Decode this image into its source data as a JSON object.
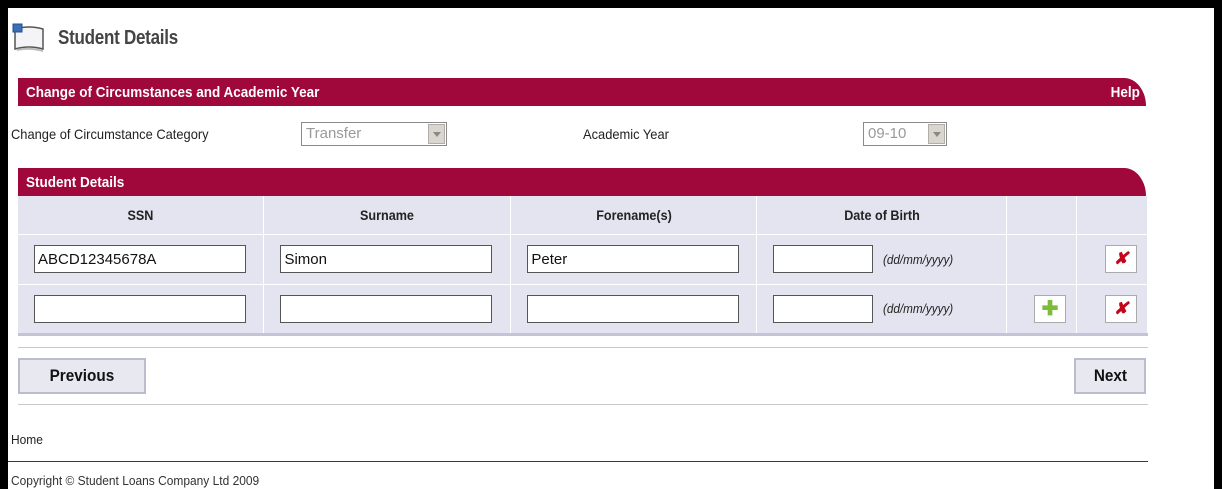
{
  "page": {
    "title": "Student Details"
  },
  "section_coc": {
    "header": "Change of Circumstances and Academic Year",
    "help_label": "Help",
    "category_label": "Change of Circumstance Category",
    "category_value": "Transfer",
    "year_label": "Academic Year",
    "year_value": "09-10"
  },
  "section_students": {
    "header": "Student Details",
    "columns": [
      "SSN",
      "Surname",
      "Forename(s)",
      "Date of Birth",
      "",
      ""
    ],
    "rows": [
      {
        "ssn": "ABCD12345678A",
        "surname": "Simon",
        "forename": "Peter",
        "dob": "",
        "dob_hint": "(dd/mm/yyyy)",
        "add_button": false,
        "delete_icon": "x-icon"
      },
      {
        "ssn": "",
        "surname": "",
        "forename": "",
        "dob": "",
        "dob_hint": "(dd/mm/yyyy)",
        "add_button": true,
        "delete_icon": "x-icon"
      }
    ]
  },
  "nav": {
    "previous_label": "Previous",
    "next_label": "Next"
  },
  "footer": {
    "home_link": "Home",
    "copyright": "Copyright © Student Loans Company Ltd 2009"
  },
  "colors": {
    "accent": "#a0073b",
    "table_bg": "#e4e4f0",
    "delete_icon": "#c4061a",
    "add_icon": "#7dbb3b"
  }
}
